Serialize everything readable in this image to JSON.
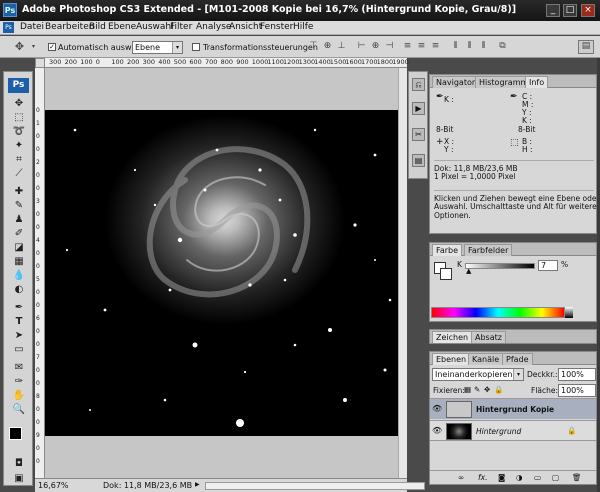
{
  "app": {
    "title": "Adobe Photoshop CS3 Extended - [M101-2008 Kopie bei 16,7% (Hintergrund Kopie, Grau/8)]",
    "logo": "Ps",
    "window_buttons": [
      "_",
      "□",
      "×"
    ]
  },
  "menu": {
    "logo": "Ps",
    "items": [
      "Datei",
      "Bearbeiten",
      "Bild",
      "Ebene",
      "Auswahl",
      "Filter",
      "Analyse",
      "Ansicht",
      "Fenster",
      "Hilfe"
    ]
  },
  "options": {
    "auto_select_label": "Automatisch auswählen:",
    "auto_select_value": "Ebene",
    "transform_label": "Transformationssteuerungen",
    "checkmark": "✓",
    "dropdown_arrow": "▾"
  },
  "ruler": {
    "h": [
      "300",
      "200",
      "100",
      "0",
      "100",
      "200",
      "300",
      "400",
      "500",
      "600",
      "700",
      "800",
      "900",
      "1000",
      "1100",
      "1200",
      "1300",
      "1400",
      "1500",
      "1600",
      "1700",
      "1800",
      "1900"
    ],
    "v": [
      "0",
      "1",
      "0",
      "0",
      "2",
      "0",
      "0",
      "3",
      "0",
      "0",
      "4",
      "0",
      "0",
      "5",
      "0",
      "0",
      "6",
      "0",
      "0",
      "7",
      "0",
      "0",
      "8",
      "0",
      "0",
      "9",
      "0",
      "0"
    ]
  },
  "status": {
    "zoom": "16,67%",
    "doc": "Dok: 11,8 MB/23,6 MB"
  },
  "info_panel": {
    "tabs": [
      "Navigator",
      "Histogramm",
      "Info"
    ],
    "k_label": "K :",
    "c_label": "C :",
    "m_label": "M :",
    "y_label": "Y :",
    "kk_label": "K :",
    "bit_left": "8-Bit",
    "bit_right": "8-Bit",
    "x_label": "X :",
    "y2_label": "Y :",
    "b_label": "B :",
    "h_label": "H :",
    "doc": "Dok: 11,8 MB/23,6 MB",
    "pixel": "1 Pixel = 1,0000 Pixel",
    "hint": [
      "Klicken und Ziehen bewegt eine Ebene oder",
      "Auswahl. Umschalttaste und Alt für weitere",
      "Optionen."
    ]
  },
  "color_panel": {
    "tabs": [
      "Farbe",
      "Farbfelder"
    ],
    "k_label": "K",
    "k_value": "7",
    "percent": "%"
  },
  "char_panel": {
    "tabs": [
      "Zeichen",
      "Absatz"
    ]
  },
  "layers_panel": {
    "tabs": [
      "Ebenen",
      "Kanäle",
      "Pfade"
    ],
    "blend_mode": "Ineinanderkopieren",
    "opacity_label": "Deckkr.:",
    "opacity_value": "100%",
    "lock_label": "Fixieren:",
    "fill_label": "Fläche:",
    "fill_value": "100%",
    "layers": [
      {
        "name": "Hintergrund Kopie"
      },
      {
        "name": "Hintergrund"
      }
    ],
    "footer_fx": "fx."
  },
  "colors": {
    "ps_blue": "#1d5fa8",
    "selected_layer": "#a8b0c0"
  }
}
